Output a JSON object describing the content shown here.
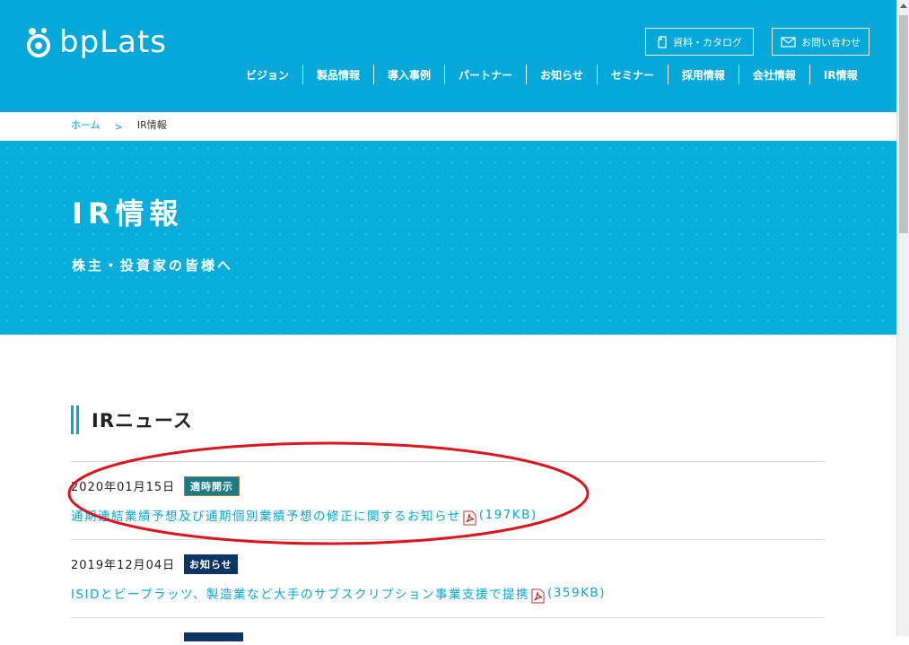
{
  "header": {
    "logo_text": "bpLats",
    "catalog_button": "資料・カタログ",
    "contact_button": "お問い合わせ",
    "nav": [
      "ビジョン",
      "製品情報",
      "導入事例",
      "パートナー",
      "お知らせ",
      "セミナー",
      "採用情報",
      "会社情報",
      "IR情報"
    ]
  },
  "breadcrumb": {
    "home": "ホーム",
    "separator": ">",
    "current": "IR情報"
  },
  "hero": {
    "title": "IR情報",
    "subtitle": "株主・投資家の皆様へ"
  },
  "section": {
    "title": "IRニュース"
  },
  "news": [
    {
      "date": "2020年01月15日",
      "badge": "適時開示",
      "badge_type": "disclosure",
      "title": "通期連結業績予想及び通期個別業績予想の修正に関するお知らせ",
      "size": "(197KB)",
      "icon": "pdf-icon"
    },
    {
      "date": "2019年12月04日",
      "badge": "お知らせ",
      "badge_type": "news",
      "title": "ISIDとビープラッツ、製造業など大手のサブスクリプション事業支援で提携",
      "size": "(359KB)",
      "icon": "pdf-icon"
    }
  ],
  "colors": {
    "brand": "#04a8d9",
    "badge_disclosure": "#1a7a86",
    "badge_news": "#0d3563",
    "annotation": "#e0141e"
  }
}
